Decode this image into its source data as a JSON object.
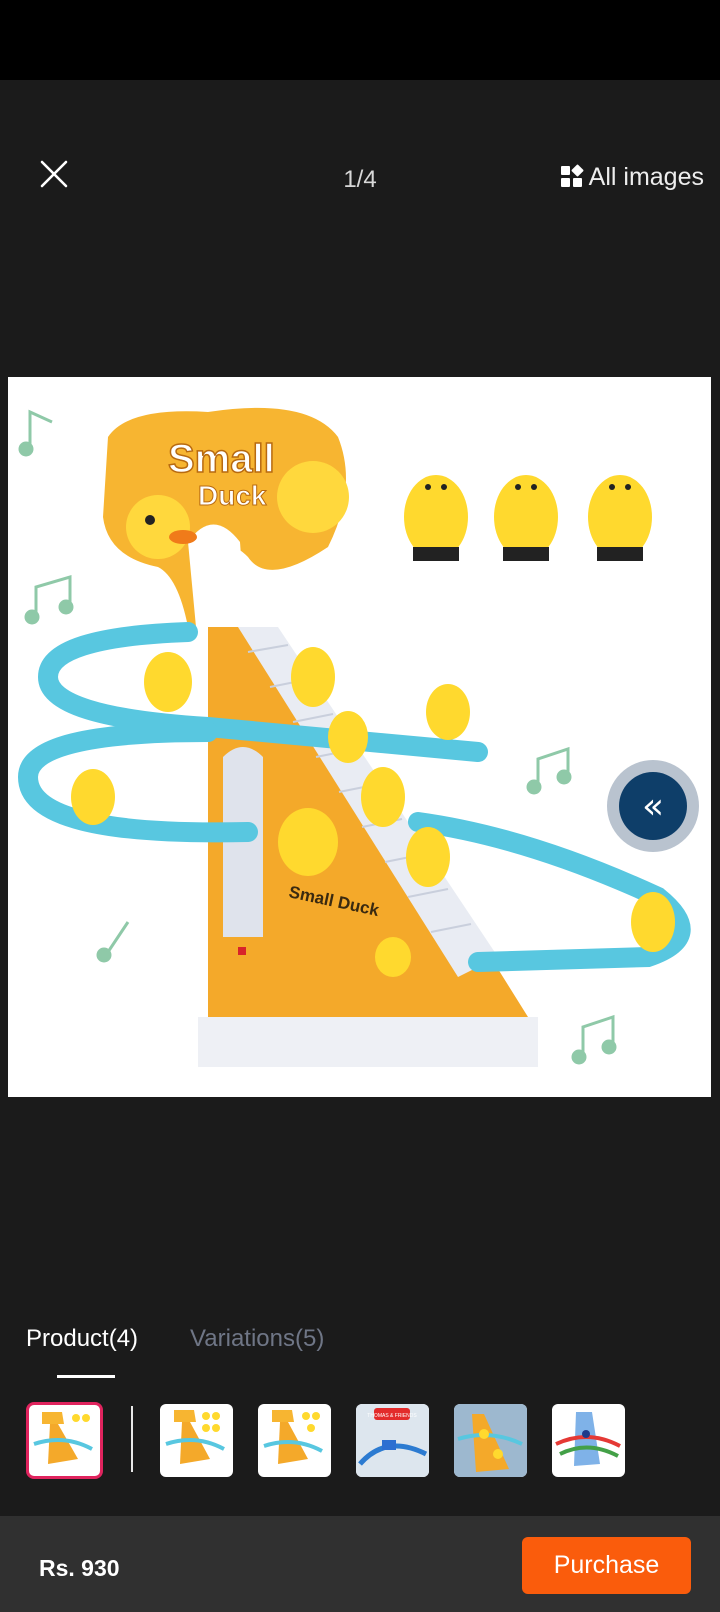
{
  "header": {
    "counter": "1/4",
    "all_images_label": "All images"
  },
  "hero_image": {
    "sign_text_line1": "Small",
    "sign_text_line2": "Duck",
    "panel_text": "Small Duck"
  },
  "tabs": [
    {
      "label": "Product(4)",
      "active": true
    },
    {
      "label": "Variations(5)",
      "active": false
    }
  ],
  "thumbnails": {
    "thumb4_text": "THOMAS & FRIENDS"
  },
  "footer": {
    "price": "Rs. 930",
    "purchase_label": "Purchase"
  },
  "colors": {
    "purchase": "#fa5c0c",
    "selected_border": "#e0245e",
    "collapse_button": "#0e3e69"
  }
}
